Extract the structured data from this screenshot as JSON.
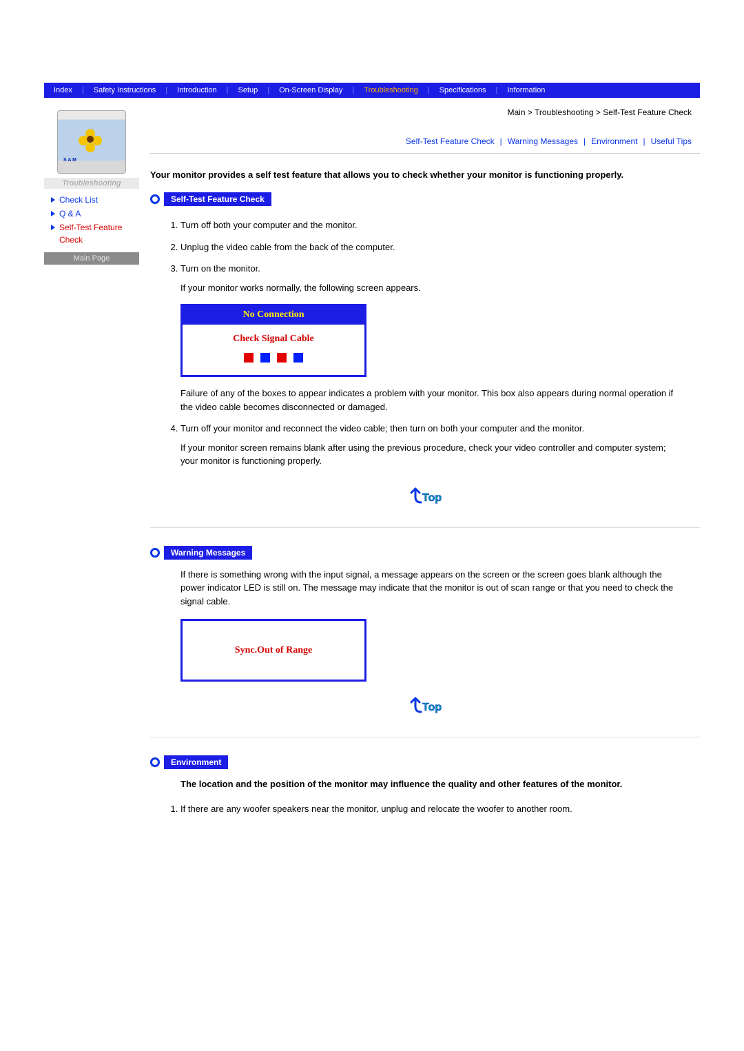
{
  "topnav": {
    "items": [
      "Index",
      "Safety Instructions",
      "Introduction",
      "Setup",
      "On-Screen Display",
      "Troubleshooting",
      "Specifications",
      "Information"
    ],
    "active": 5
  },
  "sidebar": {
    "brand": "S A M",
    "category": "Troubleshooting",
    "items": [
      {
        "label": "Check List"
      },
      {
        "label": "Q & A"
      },
      {
        "label": "Self-Test Feature Check",
        "current": true
      }
    ],
    "mainpage": "Main Page"
  },
  "breadcrumb": "Main > Troubleshooting > Self-Test Feature Check",
  "anchors": [
    "Self-Test Feature Check",
    "Warning Messages",
    "Environment",
    "Useful Tips"
  ],
  "intro": "Your monitor provides a self test feature that allows you to check whether your monitor is functioning properly.",
  "sections": {
    "selftest_label": "Self-Test Feature Check",
    "warning_label": "Warning Messages",
    "env_label": "Environment"
  },
  "steps": {
    "s1": "Turn off both your computer and the monitor.",
    "s2": "Unplug the video cable from the back of the computer.",
    "s3": "Turn on the monitor.",
    "s3_sub": "If your monitor works normally, the following screen appears.",
    "nc_head": "No Connection",
    "nc_msg": "Check Signal Cable",
    "s3_fail": "Failure of any of the boxes to appear indicates a problem with your monitor. This box also appears during normal operation if the video cable becomes disconnected or damaged.",
    "s4": "Turn off your monitor and reconnect the video cable; then turn on both your computer and the monitor.",
    "s4_sub": "If your monitor screen remains blank after using the previous procedure, check your video controller and computer system; your monitor is functioning properly."
  },
  "warning_body": "If there is something wrong with the input signal, a message appears on the screen or the screen goes blank although the power indicator LED is still on. The message may indicate that the monitor is out of scan range or that you need to check the signal cable.",
  "sync_msg": "Sync.Out of Range",
  "env_intro": "The location and the position of the monitor may influence the quality and other features of the monitor.",
  "env_step1": "If there are any woofer speakers near the monitor, unplug and relocate the woofer to another room.",
  "top_label": "Top"
}
